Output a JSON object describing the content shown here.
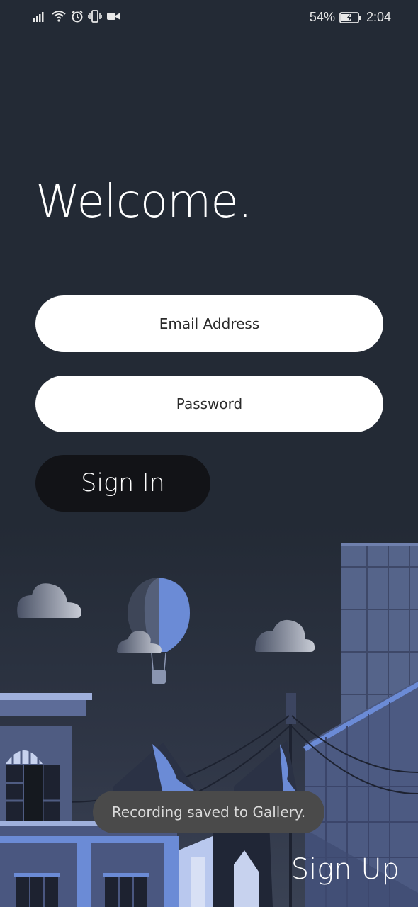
{
  "status_bar": {
    "battery_percent": "54%",
    "time": "2:04",
    "left_icons": [
      "signal-icon",
      "wifi-icon",
      "alarm-icon",
      "vibrate-icon",
      "screen-record-icon"
    ],
    "right_icons": [
      "battery-charging-icon"
    ]
  },
  "welcome": {
    "title": "Welcome."
  },
  "form": {
    "email_placeholder": "Email Address",
    "password_placeholder": "Password",
    "sign_in_label": "Sign In"
  },
  "toast": {
    "message": "Recording saved to Gallery."
  },
  "footer": {
    "sign_up_label": "Sign Up"
  },
  "colors": {
    "background": "#232a35",
    "input_bg": "#ffffff",
    "sign_in_bg": "#121317",
    "illustration_blue": "#6b8bd6",
    "toast_bg": "#4a4a4a"
  }
}
